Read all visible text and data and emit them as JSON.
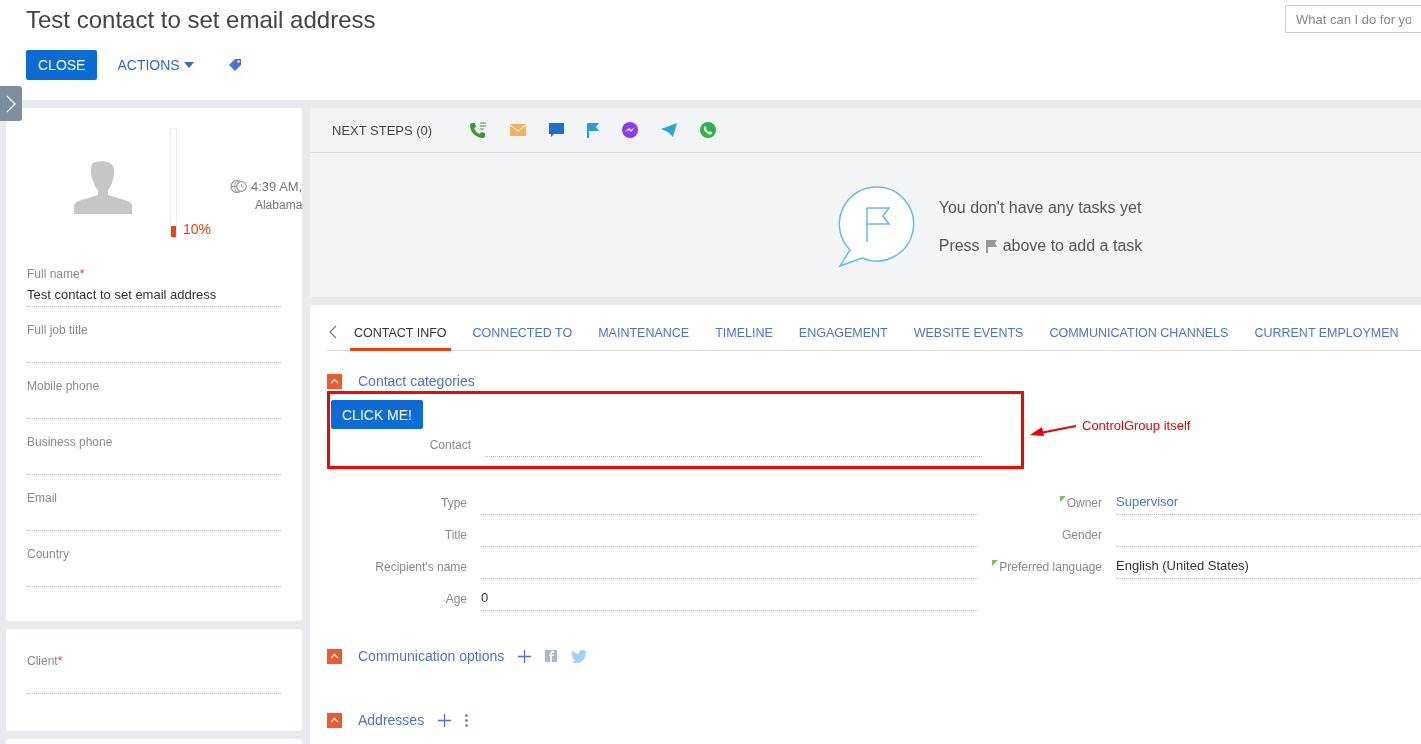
{
  "header": {
    "title": "Test contact to set email address",
    "search": {
      "placeholder": "What can I do for yo"
    },
    "close": "CLOSE",
    "actions": "ACTIONS"
  },
  "profile": {
    "completeness": {
      "level": 0.1,
      "reading": "10%"
    },
    "time": "4:39 AM,",
    "location": "Alabama",
    "fields": [
      {
        "label": "Full name",
        "required_mark": "*",
        "value": "Test contact to set email address"
      },
      {
        "label": "Full job title"
      },
      {
        "label": "Mobile phone"
      },
      {
        "label": "Business phone"
      },
      {
        "label": "Email"
      },
      {
        "label": "Country"
      }
    ]
  },
  "client_card": {
    "fields": [
      {
        "label": "Client",
        "required_mark": "*"
      }
    ]
  },
  "next_steps": {
    "title": "NEXT STEPS (0)",
    "empty_message": "You don't have any tasks yet",
    "hint_before": "Press",
    "hint_after": "above to add a task"
  },
  "tabs": [
    {
      "label": "CONTACT INFO",
      "selected": true
    },
    {
      "label": "CONNECTED TO",
      "selected": false
    },
    {
      "label": "MAINTENANCE",
      "selected": false
    },
    {
      "label": "TIMELINE",
      "selected": false
    },
    {
      "label": "ENGAGEMENT",
      "selected": false
    },
    {
      "label": "WEBSITE EVENTS",
      "selected": false
    },
    {
      "label": "COMMUNICATION CHANNELS",
      "selected": false
    },
    {
      "label": "CURRENT EMPLOYMEN",
      "selected": false
    }
  ],
  "categories": {
    "title": "Contact categories",
    "expanded": true,
    "button": "CLICK ME!",
    "fields": [
      {
        "label": "Contact"
      }
    ],
    "annotation": "ControlGroup itself"
  },
  "details": {
    "left": [
      {
        "label": "Type"
      },
      {
        "label": "Title"
      },
      {
        "label": "Recipient's name"
      },
      {
        "label": "Age",
        "value": "0"
      }
    ],
    "right": [
      {
        "label": "Owner",
        "value": "Supervisor",
        "link": true,
        "marked": true
      },
      {
        "label": "Gender",
        "marked": false
      },
      {
        "label": "Preferred language",
        "value": "English (United States)",
        "link": false,
        "marked": true
      }
    ]
  },
  "sections": [
    {
      "title": "Communication options",
      "expanded": true,
      "kind": "social"
    },
    {
      "title": "Addresses",
      "expanded": true,
      "kind": "menu"
    }
  ]
}
